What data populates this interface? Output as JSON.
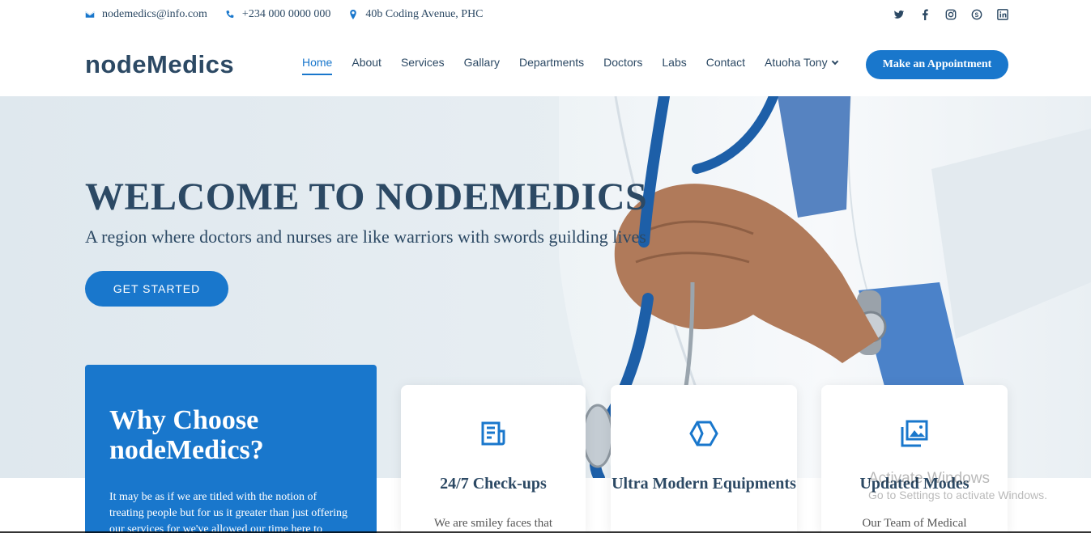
{
  "topbar": {
    "email": "nodemedics@info.com",
    "phone": "+234 000 0000 000",
    "address": "40b Coding Avenue, PHC",
    "social_icons": [
      "twitter-icon",
      "facebook-icon",
      "instagram-icon",
      "skype-icon",
      "linkedin-icon"
    ]
  },
  "header": {
    "logo": "nodeMedics",
    "nav": [
      "Home",
      "About",
      "Services",
      "Gallary",
      "Departments",
      "Doctors",
      "Labs",
      "Contact"
    ],
    "user": "Atuoha Tony",
    "cta": "Make an Appointment"
  },
  "hero": {
    "title": "WELCOME TO NODEMEDICS",
    "subtitle": "A region where doctors and nurses are like warriors with swords guilding lives",
    "button": "GET STARTED"
  },
  "why": {
    "title": "Why Choose nodeMedics?",
    "text": "It may be as if we are titled with the notion of treating people but for us it greater than just offering our services for we've allowed our time here to"
  },
  "cards": [
    {
      "icon": "receipt-icon",
      "title": "24/7 Check-ups",
      "text": "We are smiley faces that"
    },
    {
      "icon": "cube-icon",
      "title": "Ultra Modern Equipments",
      "text": ""
    },
    {
      "icon": "images-icon",
      "title": "Updated Modes",
      "text": "Our Team of Medical"
    }
  ],
  "watermark": {
    "line1": "Activate Windows",
    "line2": "Go to Settings to activate Windows."
  },
  "colors": {
    "accent": "#1977cc",
    "heading": "#2c4964"
  }
}
